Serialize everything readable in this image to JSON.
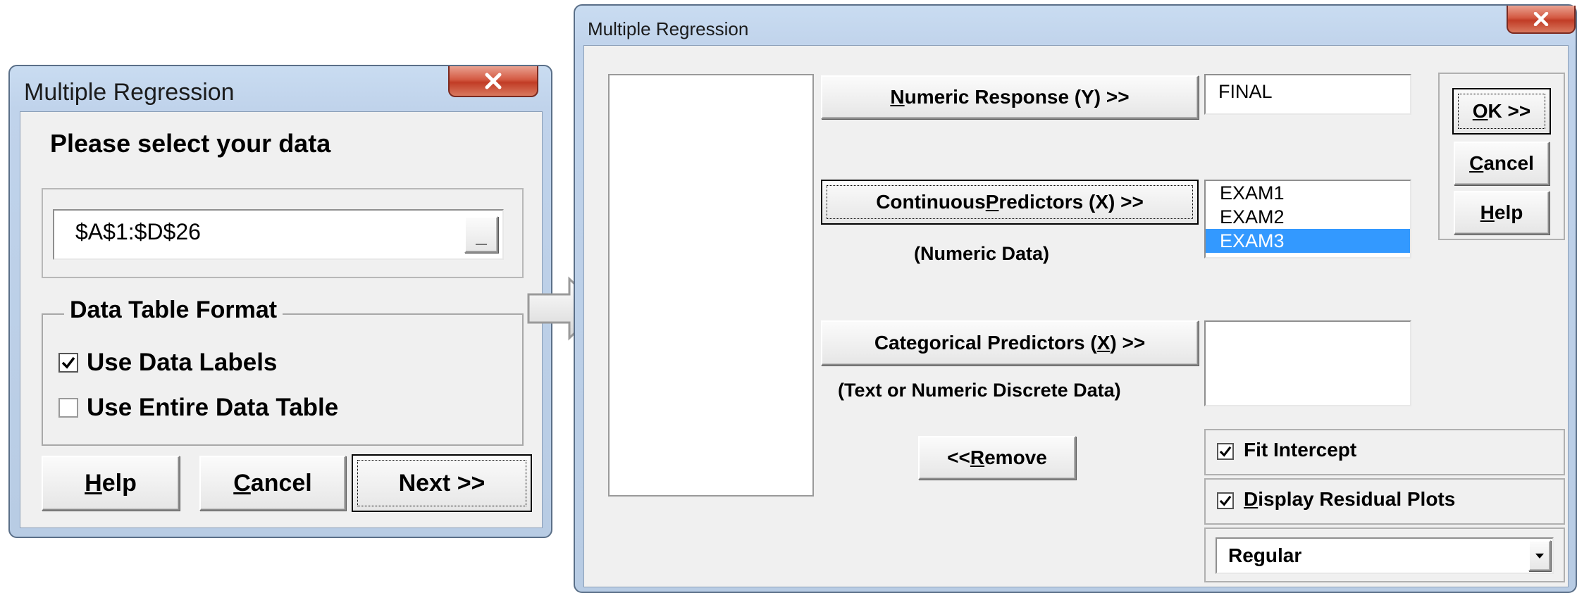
{
  "dialog1": {
    "title": "Multiple Regression",
    "prompt": "Please select your data",
    "range_value": "$A$1:$D$26",
    "range_button_label": "_",
    "format_group_label": "Data Table Format",
    "use_data_labels": {
      "label": "Use Data Labels",
      "checked": true
    },
    "use_entire_table": {
      "label": "Use Entire Data Table",
      "checked": false
    },
    "buttons": {
      "help": {
        "mnemonic": "H",
        "rest": "elp"
      },
      "cancel": {
        "mnemonic": "C",
        "rest": "ancel"
      },
      "next": "Next >>"
    }
  },
  "dialog2": {
    "title": "Multiple Regression",
    "numeric_response_btn": {
      "mnemonic": "N",
      "rest": "umeric Response (Y) >>"
    },
    "response_value": "FINAL",
    "continuous_btn": {
      "pre": "Continuous ",
      "mnemonic": "P",
      "rest": "redictors (X) >>"
    },
    "continuous_items": [
      "EXAM1",
      "EXAM2",
      "EXAM3"
    ],
    "continuous_selected": "EXAM3",
    "numeric_data_note": "(Numeric Data)",
    "categorical_btn": {
      "pre": "Categorical Predictors (",
      "mnemonic": "X",
      "rest": ") >>"
    },
    "categorical_note": "(Text or Numeric Discrete Data)",
    "remove_btn": {
      "pre": "<< ",
      "mnemonic": "R",
      "rest": "emove"
    },
    "ok_btn": {
      "mnemonic": "O",
      "rest": "K >>"
    },
    "cancel_btn": {
      "mnemonic": "C",
      "rest": "ancel"
    },
    "help_btn": {
      "mnemonic": "H",
      "rest": "elp"
    },
    "fit_intercept": {
      "label": "Fit Intercept",
      "checked": true
    },
    "display_residual": {
      "mnemonic": "D",
      "rest": "isplay Residual Plots",
      "checked": true
    },
    "residual_type": "Regular"
  },
  "icons": {
    "close": "close-icon",
    "arrow": "right-arrow-icon",
    "check": "checkmark-icon",
    "dropdown": "chevron-down-icon"
  }
}
